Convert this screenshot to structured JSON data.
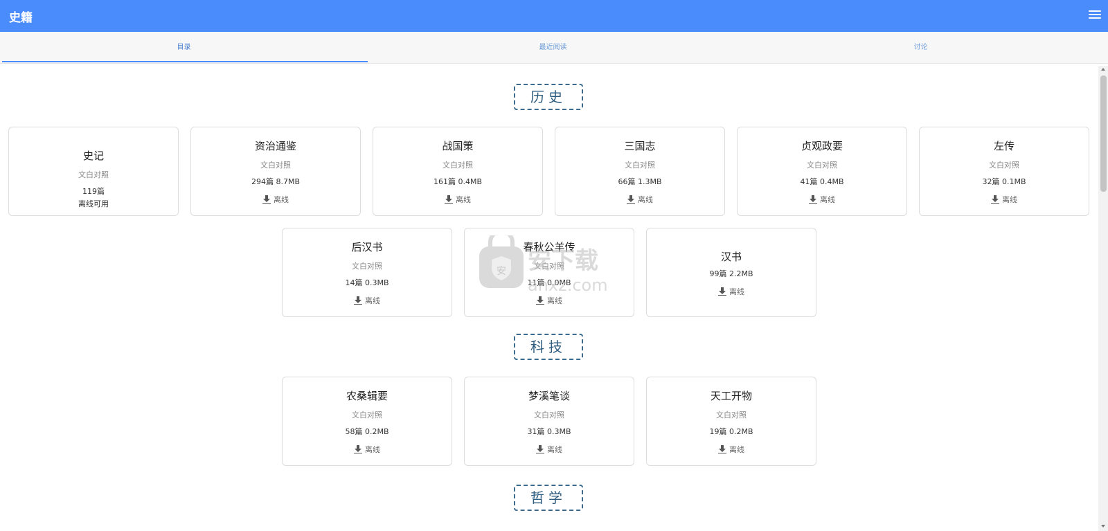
{
  "app": {
    "title": "史籍",
    "menu_icon": "menu-icon"
  },
  "tabs": [
    {
      "label": "目录",
      "active": true
    },
    {
      "label": "最近阅读",
      "active": false
    },
    {
      "label": "讨论",
      "active": false
    }
  ],
  "sections": {
    "history": "历史",
    "science": "科技",
    "philosophy": "哲学"
  },
  "download_label": "离线",
  "books": {
    "shiji": {
      "name": "史记",
      "sub": "文白对照",
      "meta": "119篇",
      "status": "离线可用"
    },
    "zizhi": {
      "name": "资治通鉴",
      "sub": "文白对照",
      "meta": "294篇 8.7MB"
    },
    "zhanguo": {
      "name": "战国策",
      "sub": "文白对照",
      "meta": "161篇 0.4MB"
    },
    "sanguo": {
      "name": "三国志",
      "sub": "文白对照",
      "meta": "66篇 1.3MB"
    },
    "zhenguan": {
      "name": "贞观政要",
      "sub": "文白对照",
      "meta": "41篇 0.4MB"
    },
    "zuozhuan": {
      "name": "左传",
      "sub": "文白对照",
      "meta": "32篇 0.1MB"
    },
    "houhan": {
      "name": "后汉书",
      "sub": "文白对照",
      "meta": "14篇 0.3MB"
    },
    "gongyang": {
      "name": "春秋公羊传",
      "sub": "文白对照",
      "meta": "11篇 0.0MB"
    },
    "hanshu": {
      "name": "汉书",
      "meta": "99篇 2.2MB"
    },
    "nongsang": {
      "name": "农桑辑要",
      "sub": "文白对照",
      "meta": "58篇 0.2MB"
    },
    "mengxi": {
      "name": "梦溪笔谈",
      "sub": "文白对照",
      "meta": "31篇 0.3MB"
    },
    "tiangong": {
      "name": "天工开物",
      "sub": "文白对照",
      "meta": "19篇 0.2MB"
    }
  },
  "watermark": {
    "text": "安下载",
    "domain": "anxz.com",
    "badge": "安"
  }
}
